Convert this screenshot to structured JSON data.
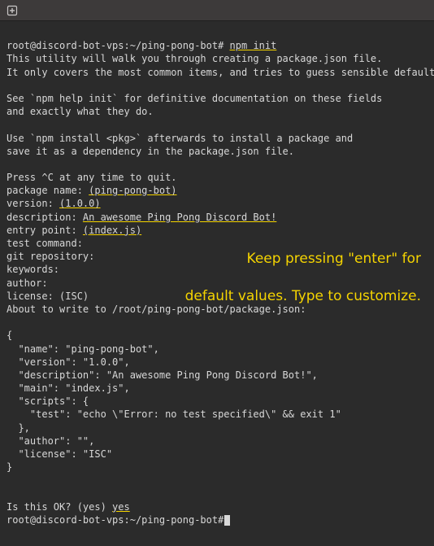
{
  "titlebar": {
    "new_tab_icon": "new-tab"
  },
  "prompt": {
    "user": "root",
    "host": "discord-bot-vps",
    "path": "~/ping-pong-bot",
    "full": "root@discord-bot-vps:~/ping-pong-bot#"
  },
  "command": "npm init",
  "intro": {
    "l1": "This utility will walk you through creating a package.json file.",
    "l2": "It only covers the most common items, and tries to guess sensible defaults.",
    "l3": "See `npm help init` for definitive documentation on these fields",
    "l4": "and exactly what they do.",
    "l5": "Use `npm install <pkg>` afterwards to install a package and",
    "l6": "save it as a dependency in the package.json file.",
    "l7": "Press ^C at any time to quit."
  },
  "fields": {
    "package_name_label": "package name: ",
    "package_name_value": "(ping-pong-bot)",
    "version_label": "version: ",
    "version_value": "(1.0.0)",
    "description_label": "description: ",
    "description_value": "An awesome Ping Pong Discord Bot!",
    "entry_point_label": "entry point: ",
    "entry_point_value": "(index.js)",
    "test_command_label": "test command:",
    "git_repository_label": "git repository:",
    "keywords_label": "keywords:",
    "author_label": "author:",
    "license_label": "license: (ISC)"
  },
  "about_line": "About to write to /root/ping-pong-bot/package.json:",
  "json_preview": {
    "open": "{",
    "name": "  \"name\": \"ping-pong-bot\",",
    "version": "  \"version\": \"1.0.0\",",
    "description": "  \"description\": \"An awesome Ping Pong Discord Bot!\",",
    "main": "  \"main\": \"index.js\",",
    "scripts_open": "  \"scripts\": {",
    "test": "    \"test\": \"echo \\\"Error: no test specified\\\" && exit 1\"",
    "scripts_close": "  },",
    "author": "  \"author\": \"\",",
    "license": "  \"license\": \"ISC\"",
    "close": "}"
  },
  "confirm": {
    "question": "Is this OK? (yes) ",
    "answer": "yes"
  },
  "annotation": {
    "l1": "Keep pressing \"enter\" for",
    "l2": "default values. Type to customize."
  }
}
